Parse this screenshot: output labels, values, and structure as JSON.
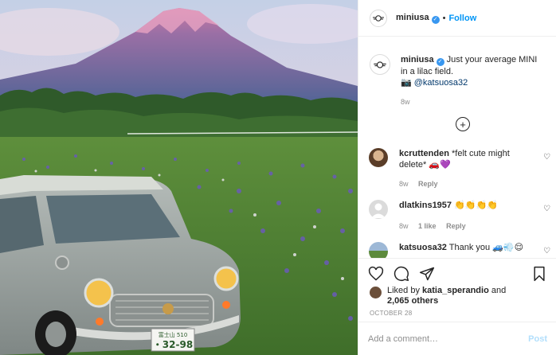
{
  "post_image": {
    "alt_icon": "photo-of-mini-cooper-near-mount-fuji"
  },
  "header": {
    "username": "miniusa",
    "follow_label": "Follow",
    "dot": "•"
  },
  "caption": {
    "username": "miniusa",
    "text": " Just your average MINI in a lilac field.",
    "camera_emoji": "📷",
    "mention": " @katsuosa32",
    "age": "8w"
  },
  "comments": [
    {
      "username": "kcruttenden",
      "text": " *felt cute might delete* 🚗💜",
      "age": "8w",
      "likes": "",
      "reply": "Reply"
    },
    {
      "username": "dlatkins1957",
      "text": " 👏👏👏👏",
      "age": "8w",
      "likes": "1 like",
      "reply": "Reply"
    },
    {
      "username": "katsuosa32",
      "text": " Thank you 🚙💨😌",
      "age": "",
      "likes": "",
      "reply": ""
    }
  ],
  "likes": {
    "prefix": "Liked by ",
    "user": "katia_sperandio",
    "and": " and",
    "count": "2,065 others"
  },
  "date": "OCTOBER 28",
  "add_comment": {
    "placeholder": "Add a comment…",
    "post_label": "Post"
  },
  "colors": {
    "accent": "#0095f6",
    "post_disabled": "#b2dffc",
    "link": "#00376b"
  }
}
